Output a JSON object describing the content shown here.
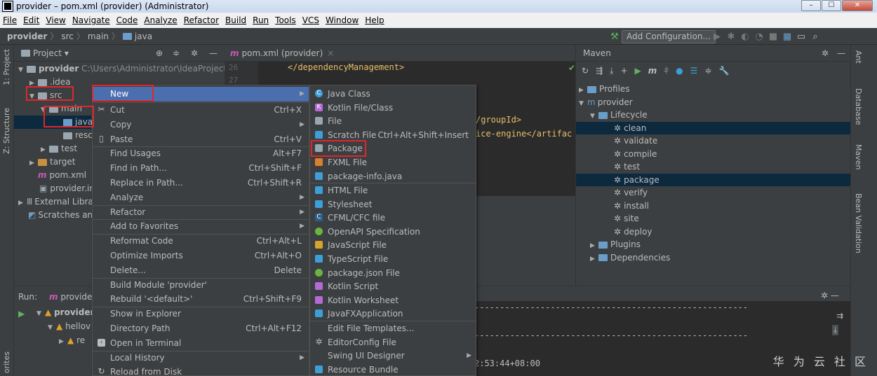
{
  "window": {
    "title": "provider – pom.xml (provider) (Administrator)",
    "min": "–",
    "max": "☐",
    "close": "✕"
  },
  "menubar": [
    "File",
    "Edit",
    "View",
    "Navigate",
    "Code",
    "Analyze",
    "Refactor",
    "Build",
    "Run",
    "Tools",
    "VCS",
    "Window",
    "Help"
  ],
  "breadcrumb": [
    "provider",
    "src",
    "main",
    "java"
  ],
  "toolbar": {
    "add_config": "Add Configuration..."
  },
  "left_strip": {
    "project": "1: Project",
    "structure": "Z: Structure",
    "favorites": "orites"
  },
  "right_strip": {
    "ant": "Ant",
    "database": "Database",
    "maven": "Maven",
    "bean": "Bean Validation"
  },
  "project_panel": {
    "title": "Project ▾",
    "tree": [
      {
        "label": "provider",
        "path": "C:\\Users\\Administrator\\IdeaProjects\\p"
      },
      {
        "label": ".idea"
      },
      {
        "label": "src"
      },
      {
        "label": "main"
      },
      {
        "label": "java"
      },
      {
        "label": "resc"
      },
      {
        "label": "test"
      },
      {
        "label": "target"
      },
      {
        "label": "pom.xml"
      },
      {
        "label": "provider.ir"
      },
      {
        "label": "External Libra"
      },
      {
        "label": "Scratches anc"
      }
    ]
  },
  "editor": {
    "tab": "pom.xml (provider)",
    "lines": [
      "26",
      "27"
    ],
    "code": [
      "</dependencyManagement>",
      "/groupId>",
      "ice-engine</artifac"
    ]
  },
  "maven": {
    "title": "Maven",
    "items": [
      "Profiles",
      "provider",
      "Lifecycle",
      "clean",
      "validate",
      "compile",
      "test",
      "package",
      "verify",
      "install",
      "site",
      "deploy",
      "Plugins",
      "Dependencies"
    ]
  },
  "run_panel": {
    "label": "Run:",
    "config": "provider",
    "tree": [
      "provider",
      "hellov",
      "re"
    ],
    "console_lines": [
      "------------------------------------------------------",
      "------------------------------------------------------",
      "2:53:44+08:00"
    ]
  },
  "context_menu": [
    {
      "label": "New",
      "shortcut": ""
    },
    {
      "label": "Cut",
      "shortcut": "Ctrl+X"
    },
    {
      "label": "Copy",
      "shortcut": ""
    },
    {
      "label": "Paste",
      "shortcut": "Ctrl+V"
    },
    {
      "label": "Find Usages",
      "shortcut": "Alt+F7"
    },
    {
      "label": "Find in Path...",
      "shortcut": "Ctrl+Shift+F"
    },
    {
      "label": "Replace in Path...",
      "shortcut": "Ctrl+Shift+R"
    },
    {
      "label": "Analyze",
      "shortcut": ""
    },
    {
      "label": "Refactor",
      "shortcut": ""
    },
    {
      "label": "Add to Favorites",
      "shortcut": ""
    },
    {
      "label": "Reformat Code",
      "shortcut": "Ctrl+Alt+L"
    },
    {
      "label": "Optimize Imports",
      "shortcut": "Ctrl+Alt+O"
    },
    {
      "label": "Delete...",
      "shortcut": "Delete"
    },
    {
      "label": "Build Module 'provider'",
      "shortcut": ""
    },
    {
      "label": "Rebuild '<default>'",
      "shortcut": "Ctrl+Shift+F9"
    },
    {
      "label": "Show in Explorer",
      "shortcut": ""
    },
    {
      "label": "Directory Path",
      "shortcut": "Ctrl+Alt+F12"
    },
    {
      "label": "Open in Terminal",
      "shortcut": ""
    },
    {
      "label": "Local History",
      "shortcut": ""
    },
    {
      "label": "Reload from Disk",
      "shortcut": ""
    }
  ],
  "new_submenu": [
    {
      "label": "Java Class",
      "shortcut": ""
    },
    {
      "label": "Kotlin File/Class",
      "shortcut": ""
    },
    {
      "label": "File",
      "shortcut": ""
    },
    {
      "label": "Scratch File",
      "shortcut": "Ctrl+Alt+Shift+Insert"
    },
    {
      "label": "Package",
      "shortcut": ""
    },
    {
      "label": "FXML File",
      "shortcut": ""
    },
    {
      "label": "package-info.java",
      "shortcut": ""
    },
    {
      "label": "HTML File",
      "shortcut": ""
    },
    {
      "label": "Stylesheet",
      "shortcut": ""
    },
    {
      "label": "CFML/CFC file",
      "shortcut": ""
    },
    {
      "label": "OpenAPI Specification",
      "shortcut": ""
    },
    {
      "label": "JavaScript File",
      "shortcut": ""
    },
    {
      "label": "TypeScript File",
      "shortcut": ""
    },
    {
      "label": "package.json File",
      "shortcut": ""
    },
    {
      "label": "Kotlin Script",
      "shortcut": ""
    },
    {
      "label": "Kotlin Worksheet",
      "shortcut": ""
    },
    {
      "label": "JavaFXApplication",
      "shortcut": ""
    },
    {
      "label": "Edit File Templates...",
      "shortcut": ""
    },
    {
      "label": "EditorConfig File",
      "shortcut": ""
    },
    {
      "label": "Swing UI Designer",
      "shortcut": ""
    },
    {
      "label": "Resource Bundle",
      "shortcut": ""
    }
  ],
  "watermark": "华 为 云 社 区",
  "colors": {
    "highlight": "#e0262b",
    "selection": "#4b6eaf",
    "accent_blue": "#6a9ec9"
  }
}
